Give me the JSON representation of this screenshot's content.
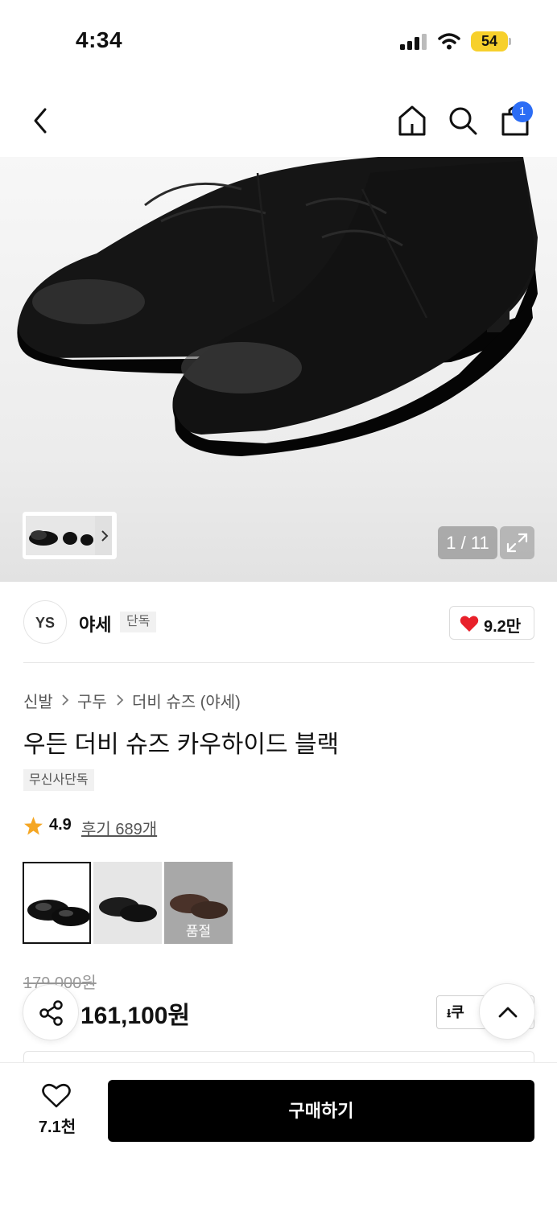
{
  "status_bar": {
    "time": "4:34",
    "battery": "54"
  },
  "header": {
    "cart_count": "1"
  },
  "gallery": {
    "counter": "1 / 11"
  },
  "brand": {
    "name": "야세",
    "tag": "단독",
    "logo_text": "YS",
    "likes": "9.2만"
  },
  "breadcrumb": [
    "신발",
    "구두",
    "더비 슈즈 (야세)"
  ],
  "product": {
    "title": "우든 더비 슈즈 카우하이드 블랙",
    "badge": "무신사단독",
    "rating": "4.9",
    "reviews_label": "후기 689개",
    "options": [
      {
        "color": "#1a1a1a",
        "selected": true,
        "soldout": ""
      },
      {
        "color": "#2a2a2a",
        "selected": false,
        "soldout": ""
      },
      {
        "color": "#4a3229",
        "selected": false,
        "soldout": "품절"
      }
    ],
    "original_price": "179,000원",
    "price": "161,100원",
    "coupon_label": "쿠"
  },
  "bottom": {
    "wish_count": "7.1천",
    "buy_label": "구매하기"
  },
  "colors": {
    "accent_blue": "#2c6df5",
    "heart_red": "#e8202a",
    "star_gold": "#f5a623",
    "battery_yellow": "#f7d02c"
  }
}
